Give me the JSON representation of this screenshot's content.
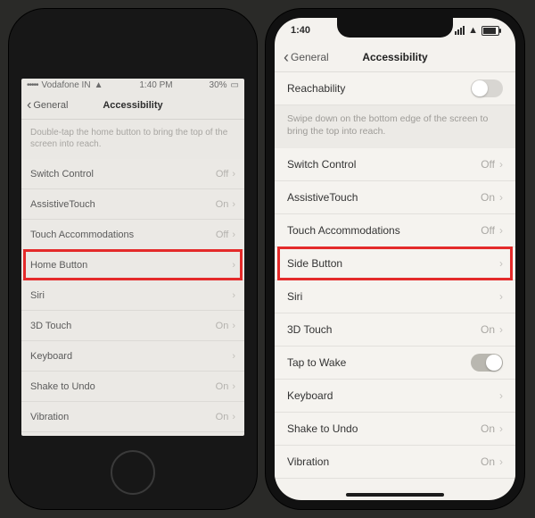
{
  "left": {
    "status": {
      "carrier": "Vodafone IN",
      "time": "1:40 PM",
      "battery": "30%"
    },
    "nav": {
      "back": "General",
      "title": "Accessibility"
    },
    "helper": "Double-tap the home button to bring the top of the screen into reach.",
    "rows": [
      {
        "label": "Switch Control",
        "value": "Off"
      },
      {
        "label": "AssistiveTouch",
        "value": "On"
      },
      {
        "label": "Touch Accommodations",
        "value": "Off"
      },
      {
        "label": "Home Button",
        "value": ""
      },
      {
        "label": "Siri",
        "value": ""
      },
      {
        "label": "3D Touch",
        "value": "On"
      },
      {
        "label": "Keyboard",
        "value": ""
      },
      {
        "label": "Shake to Undo",
        "value": "On"
      },
      {
        "label": "Vibration",
        "value": "On"
      }
    ]
  },
  "right": {
    "status": {
      "time": "1:40"
    },
    "nav": {
      "back": "General",
      "title": "Accessibility"
    },
    "reachability": "Reachability",
    "helper": "Swipe down on the bottom edge of the screen to bring the top into reach.",
    "rows": [
      {
        "label": "Switch Control",
        "value": "Off"
      },
      {
        "label": "AssistiveTouch",
        "value": "On"
      },
      {
        "label": "Touch Accommodations",
        "value": "Off"
      },
      {
        "label": "Side Button",
        "value": ""
      },
      {
        "label": "Siri",
        "value": ""
      },
      {
        "label": "3D Touch",
        "value": "On"
      },
      {
        "label": "Tap to Wake",
        "value": ""
      },
      {
        "label": "Keyboard",
        "value": ""
      },
      {
        "label": "Shake to Undo",
        "value": "On"
      },
      {
        "label": "Vibration",
        "value": "On"
      }
    ]
  }
}
